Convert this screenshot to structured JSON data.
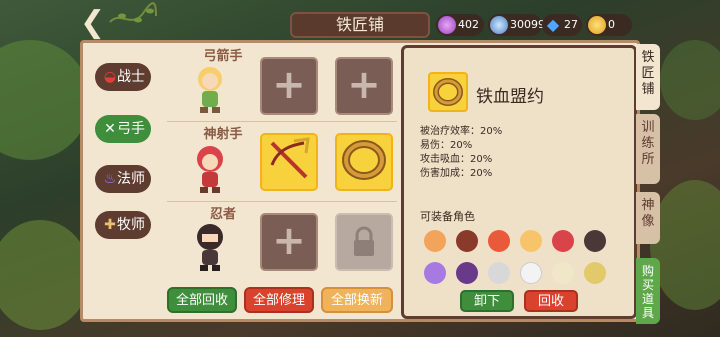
{
  "header": {
    "title": "铁匠铺",
    "currencies": [
      {
        "icon": "purple-orb-icon",
        "value": "402"
      },
      {
        "icon": "blue-wing-icon",
        "value": "30099"
      },
      {
        "icon": "diamond-icon",
        "value": "27"
      },
      {
        "icon": "gold-coin-icon",
        "value": "0"
      }
    ]
  },
  "categories": [
    {
      "label": "战士",
      "icon": "helmet-icon",
      "active": false
    },
    {
      "label": "弓手",
      "icon": "bow-icon",
      "active": true
    },
    {
      "label": "法师",
      "icon": "flame-icon",
      "active": false
    },
    {
      "label": "牧师",
      "icon": "cross-icon",
      "active": false
    }
  ],
  "rows": [
    {
      "name": "弓箭手",
      "slots": [
        "empty",
        "empty"
      ]
    },
    {
      "name": "神射手",
      "slots": [
        "crossbow",
        "ring"
      ]
    },
    {
      "name": "忍者",
      "slots": [
        "empty",
        "locked"
      ]
    }
  ],
  "bottom_buttons": {
    "recycle_all": "全部回收",
    "repair_all": "全部修理",
    "replace_all": "全部换新"
  },
  "detail": {
    "item_name": "铁血盟约",
    "stats": [
      "被治疗效率：20%",
      "易伤：20%",
      "攻击吸血：20%",
      "伤害加成：20%"
    ],
    "equip_title": "可装备角色",
    "unequip_label": "卸下",
    "recycle_label": "回收"
  },
  "side_tabs": [
    {
      "label": "铁\n匠\n铺"
    },
    {
      "label": "训\n练\n所"
    },
    {
      "label": "神\n像"
    },
    {
      "label": "购\n买\n道\n具"
    }
  ],
  "colors": {
    "active_green": "#3f8e3c",
    "repair_red": "#d9432e",
    "replace_orange": "#f0b25a",
    "panel_bg": "#f3e6d0"
  }
}
